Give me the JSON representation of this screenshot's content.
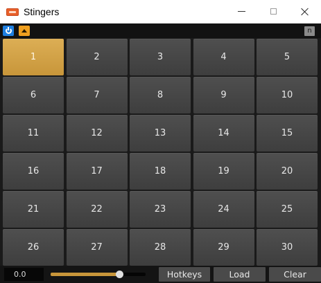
{
  "window": {
    "title": "Stingers",
    "app_icon": "app-logo-icon",
    "controls": [
      "minimize-icon",
      "maximize-icon",
      "close-icon"
    ]
  },
  "toolbar": {
    "power_icon": "power-icon",
    "power_color": "#1f7fe0",
    "collapse_icon": "caret-up-icon",
    "collapse_color": "#f0a020",
    "n_label": "n"
  },
  "pads": [
    {
      "label": "1",
      "active": true
    },
    {
      "label": "2",
      "active": false
    },
    {
      "label": "3",
      "active": false
    },
    {
      "label": "4",
      "active": false
    },
    {
      "label": "5",
      "active": false
    },
    {
      "label": "6",
      "active": false
    },
    {
      "label": "7",
      "active": false
    },
    {
      "label": "8",
      "active": false
    },
    {
      "label": "9",
      "active": false
    },
    {
      "label": "10",
      "active": false
    },
    {
      "label": "11",
      "active": false
    },
    {
      "label": "12",
      "active": false
    },
    {
      "label": "13",
      "active": false
    },
    {
      "label": "14",
      "active": false
    },
    {
      "label": "15",
      "active": false
    },
    {
      "label": "16",
      "active": false
    },
    {
      "label": "17",
      "active": false
    },
    {
      "label": "18",
      "active": false
    },
    {
      "label": "19",
      "active": false
    },
    {
      "label": "20",
      "active": false
    },
    {
      "label": "21",
      "active": false
    },
    {
      "label": "22",
      "active": false
    },
    {
      "label": "23",
      "active": false
    },
    {
      "label": "24",
      "active": false
    },
    {
      "label": "25",
      "active": false
    },
    {
      "label": "26",
      "active": false
    },
    {
      "label": "27",
      "active": false
    },
    {
      "label": "28",
      "active": false
    },
    {
      "label": "29",
      "active": false
    },
    {
      "label": "30",
      "active": false
    }
  ],
  "colors": {
    "active_pad": "#d4a44a",
    "pad": "#474747",
    "background": "#1a1a1a"
  },
  "bottom": {
    "volume_value": "0.0",
    "slider_level": 0.72,
    "hotkeys_label": "Hotkeys",
    "load_label": "Load",
    "clear_label": "Clear"
  }
}
